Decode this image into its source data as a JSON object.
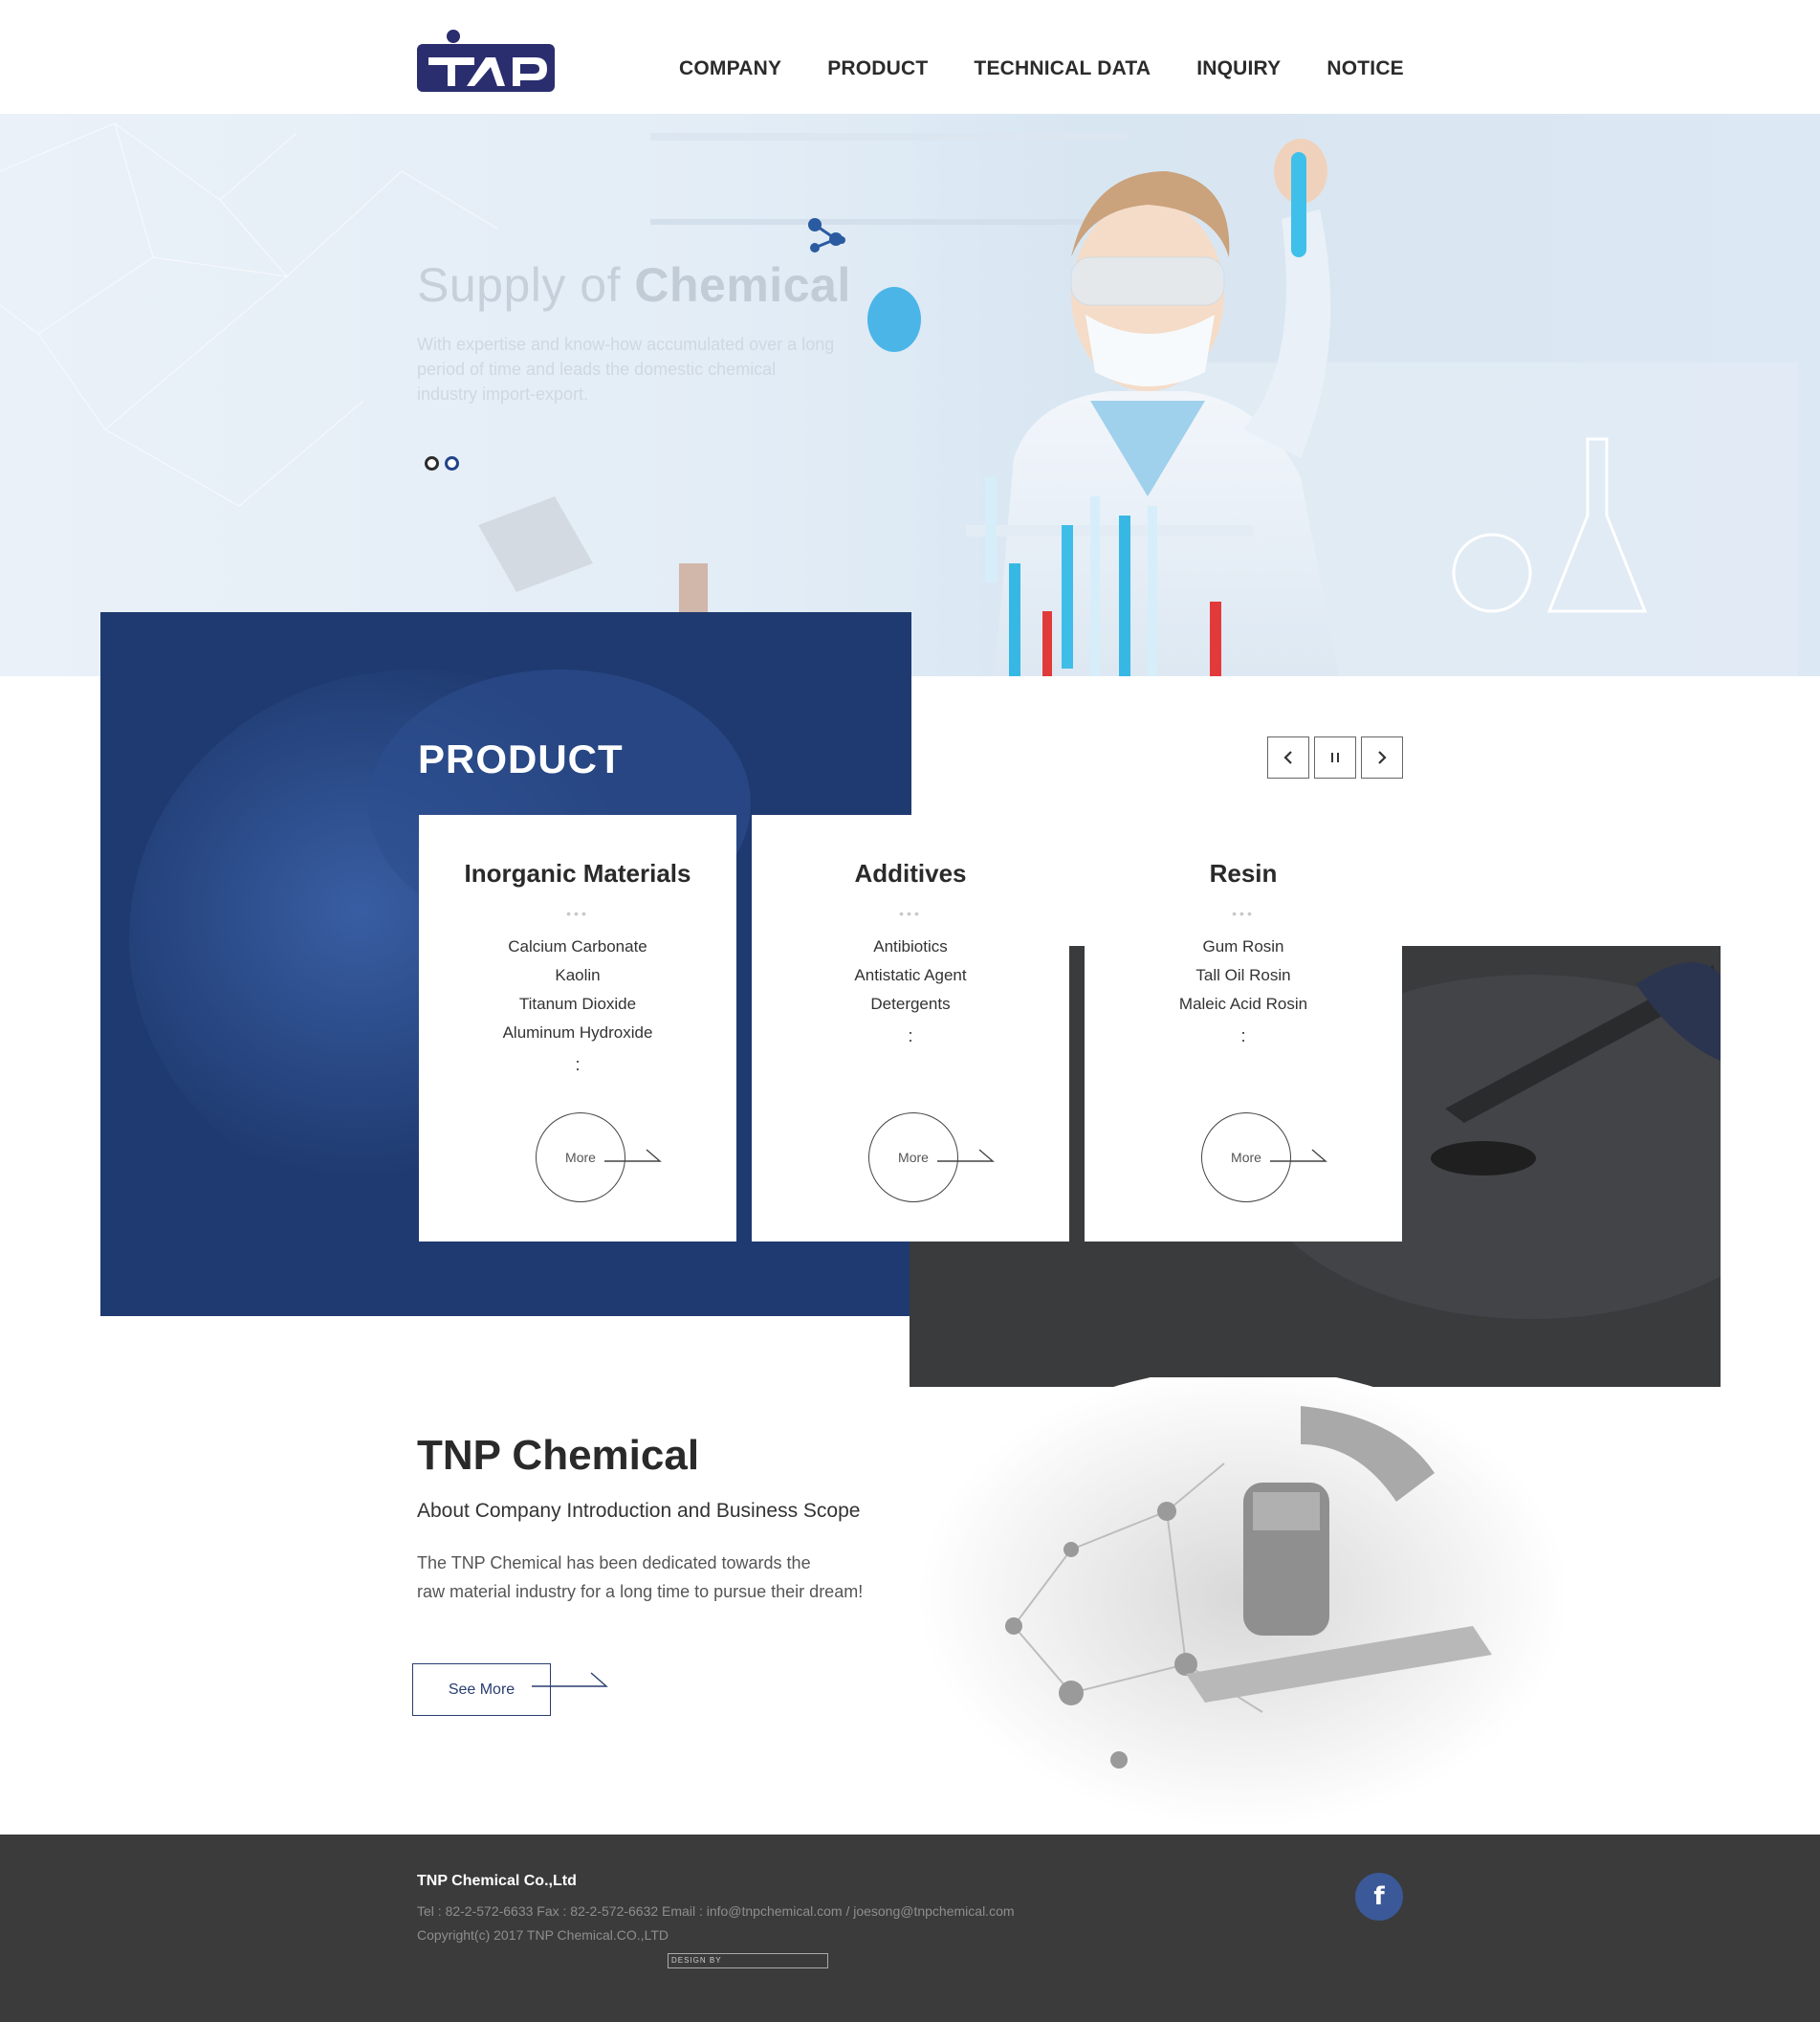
{
  "header": {
    "logo_text": "TNP",
    "nav": [
      "COMPANY",
      "PRODUCT",
      "TECHNICAL DATA",
      "INQUIRY",
      "NOTICE"
    ]
  },
  "hero": {
    "title_light": "Supply of",
    "title_bold": "Chemical",
    "subtitle": "With expertise and know-how accumulated over a long period of time and leads the domestic chemical industry import-export.",
    "slides": 2,
    "active_slide": 2
  },
  "product": {
    "title": "PRODUCT",
    "controls": {
      "prev_icon": "chevron-left-icon",
      "pause_icon": "pause-icon",
      "next_icon": "chevron-right-icon"
    },
    "cards": [
      {
        "name": "Inorganic Materials",
        "separator": "•••",
        "items": [
          "Calcium Carbonate",
          "Kaolin",
          "Titanum Dioxide",
          "Aluminum Hydroxide"
        ],
        "more_mark": ":",
        "more": "More"
      },
      {
        "name": "Additives",
        "separator": "•••",
        "items": [
          "Antibiotics",
          "Antistatic Agent",
          "Detergents"
        ],
        "more_mark": ":",
        "more": "More"
      },
      {
        "name": "Resin",
        "separator": "•••",
        "items": [
          "Gum Rosin",
          "Tall Oil Rosin",
          "Maleic Acid Rosin"
        ],
        "more_mark": ":",
        "more": "More"
      }
    ]
  },
  "about": {
    "title": "TNP Chemical",
    "subtitle": "About Company Introduction and Business Scope",
    "text_line1": "The TNP Chemical has been dedicated towards the",
    "text_line2": "raw material industry for a long time to pursue their dream!",
    "button": "See More"
  },
  "footer": {
    "company": "TNP Chemical Co.,Ltd",
    "contact": "Tel : 82-2-572-6633 Fax : 82-2-572-6632 Email : info@tnpchemical.com / joesong@tnpchemical.com",
    "copyright": "Copyright(c) 2017 TNP Chemical.CO.,LTD",
    "design_by": "DESIGN BY",
    "social_icon": "facebook-icon",
    "social_color": "#3b5998"
  },
  "colors": {
    "brand_navy": "#1f3a70",
    "dark_gray": "#3a3b3d",
    "footer_bg": "#3b3b3b"
  }
}
